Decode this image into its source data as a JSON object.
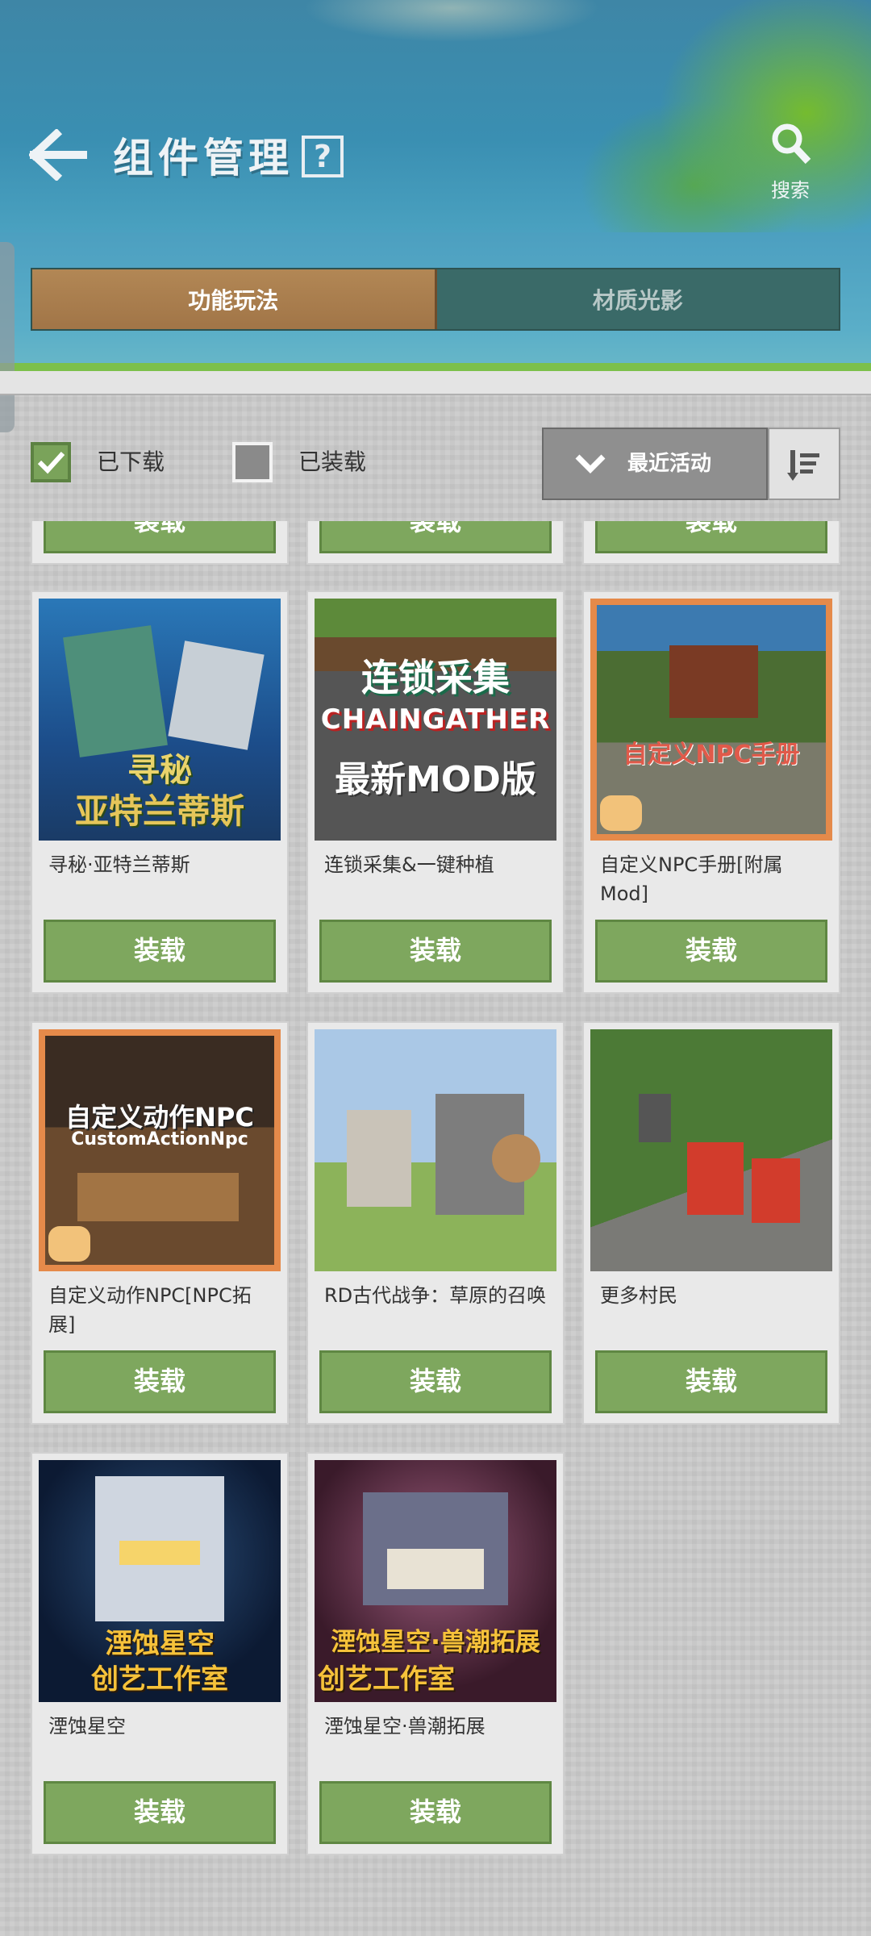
{
  "header": {
    "title": "组件管理",
    "help_label": "?",
    "search_label": "搜索"
  },
  "tabs": [
    {
      "label": "功能玩法",
      "active": true
    },
    {
      "label": "材质光影",
      "active": false
    }
  ],
  "filters": {
    "downloaded": {
      "label": "已下载",
      "checked": true
    },
    "installed": {
      "label": "已装载",
      "checked": false
    },
    "sort_label": "最近活动"
  },
  "load_button_label": "装载",
  "items": [
    {
      "name": "寻秘·亚特兰蒂斯",
      "thumb_text": [
        "寻秘",
        "亚特兰蒂斯"
      ]
    },
    {
      "name": "连锁采集&一键种植",
      "thumb_text": [
        "连锁采集",
        "CHAINGATHER",
        "最新MOD版"
      ]
    },
    {
      "name": "自定义NPC手册[附属Mod]",
      "thumb_text": [
        "自定义NPC手册"
      ]
    },
    {
      "name": "自定义动作NPC[NPC拓展]",
      "thumb_text": [
        "自定义动作NPC",
        "CustomActionNpc"
      ]
    },
    {
      "name": "RD古代战争：草原的召唤",
      "thumb_text": []
    },
    {
      "name": "更多村民",
      "thumb_text": []
    },
    {
      "name": "湮蚀星空",
      "thumb_text": [
        "湮蚀星空",
        "创艺工作室"
      ]
    },
    {
      "name": "湮蚀星空·兽潮拓展",
      "thumb_text": [
        "湮蚀星空·兽潮拓展",
        "创艺工作室"
      ]
    }
  ],
  "colors": {
    "accent_green": "#7ea75e",
    "active_tab": "#a87b4d"
  }
}
